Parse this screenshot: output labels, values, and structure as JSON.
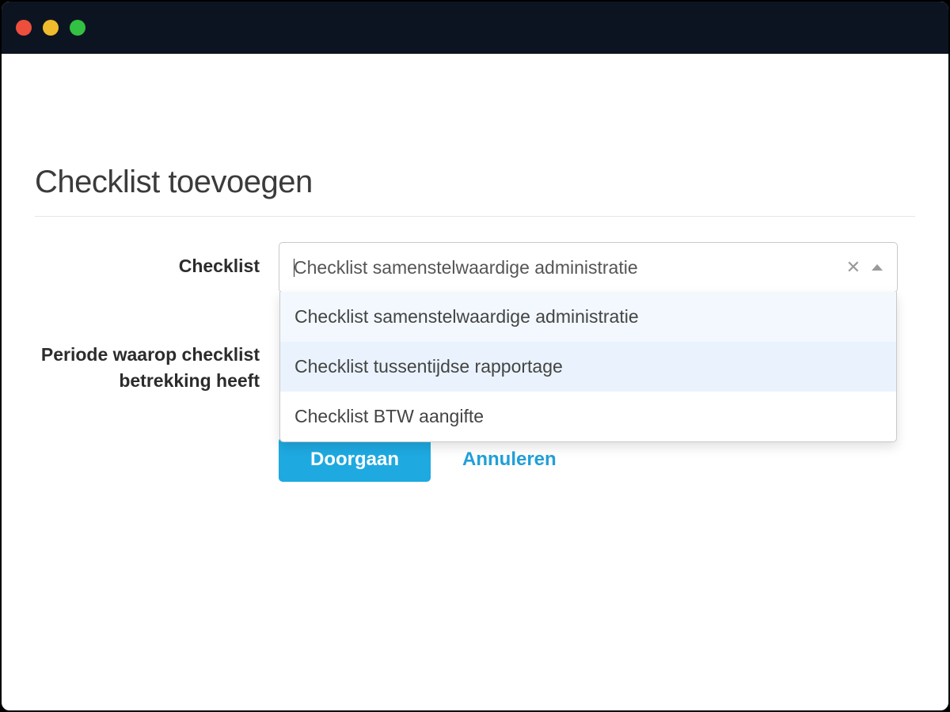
{
  "page": {
    "title": "Checklist toevoegen"
  },
  "form": {
    "checklist_label": "Checklist",
    "period_label": "Periode waarop checklist betrekking heeft",
    "checklist_select": {
      "value": "Checklist samenstelwaardige administratie",
      "options": [
        "Checklist samenstelwaardige administratie",
        "Checklist tussentijdse rapportage",
        "Checklist BTW aangifte"
      ]
    }
  },
  "buttons": {
    "primary": "Doorgaan",
    "cancel": "Annuleren"
  }
}
